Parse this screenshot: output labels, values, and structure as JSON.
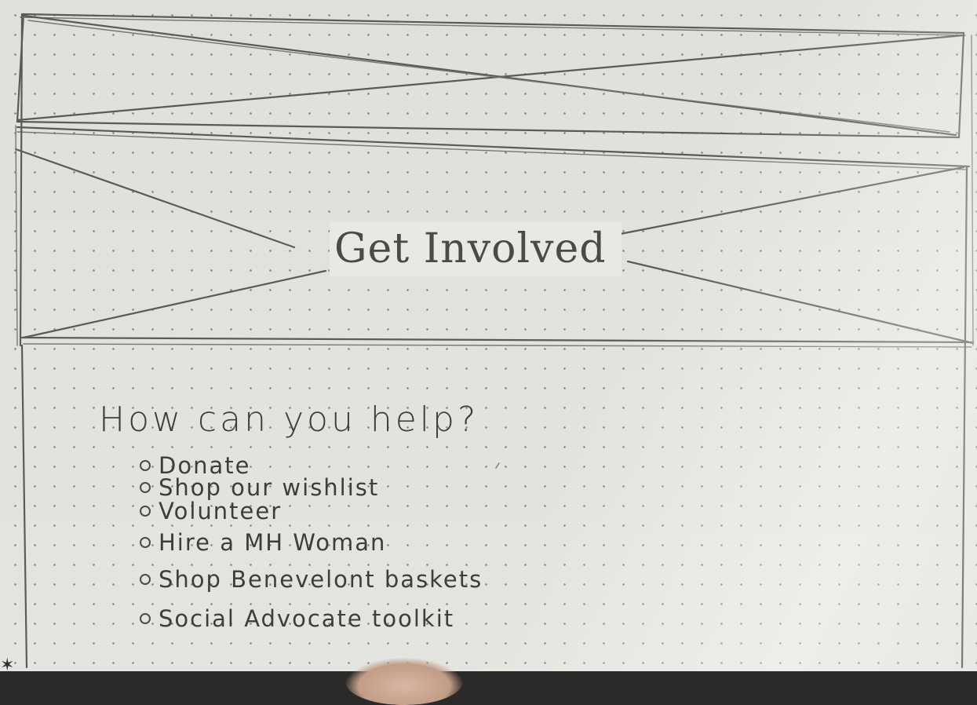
{
  "hero": {
    "title": "Get Involved"
  },
  "section": {
    "heading": "How can you help?"
  },
  "help_items": [
    "Donate",
    "Shop our wishlist",
    "Volunteer",
    "Hire a MH Woman",
    "Shop Benevelont baskets",
    "Social Advocate toolkit"
  ],
  "colors": {
    "paper": "#e9e9e4",
    "pencil": "#5d5d5a"
  }
}
